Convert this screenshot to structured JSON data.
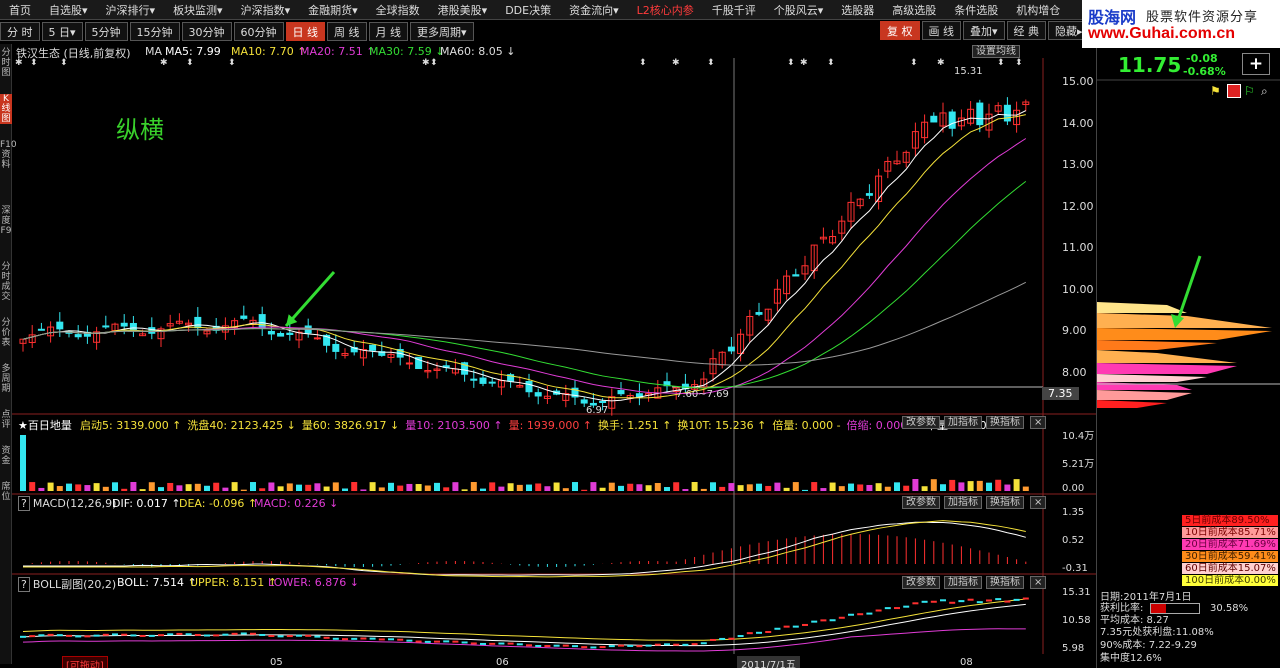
{
  "menu": [
    "首页",
    "自选股▾",
    "沪深排行▾",
    "板块监测▾",
    "沪深指数▾",
    "金融期货▾",
    "全球指数",
    "港股美股▾",
    "DDE决策",
    "资金流向▾",
    "L2核心内参",
    "千股千评",
    "个股风云▾",
    "选股器",
    "高级选股",
    "条件选股",
    "机构增仓"
  ],
  "menu_hot_index": 10,
  "logo": {
    "brand": "股海网",
    "tagline": "股票软件资源分享",
    "url": "www.Guhai.com.cn"
  },
  "periods": [
    "分 时",
    "5 日▾",
    "5分钟",
    "15分钟",
    "30分钟",
    "60分钟",
    "日 线",
    "周 线",
    "月 线",
    "更多周期▾"
  ],
  "active_period": "日 线",
  "right_buttons": [
    "复 权",
    "画 线",
    "叠加▾",
    "经 典",
    "隐藏▸"
  ],
  "left_nav": [
    "分时图",
    "K线图",
    "F10资料",
    "深度F9",
    "分时成交",
    "分价表",
    "多周期",
    "点评",
    "资金",
    "席位"
  ],
  "stock_header": "铁汉生态 (日线,前复权)",
  "ma": {
    "label": "MA",
    "ma5": "MA5: 7.99",
    "ma10": "MA10: 7.70 ↑",
    "ma20": "MA20: 7.51 ↑",
    "ma30": "MA30: 7.59 ↓",
    "ma60": "MA60: 8.05 ↓"
  },
  "settings_btn": "设置均线",
  "annotation": "纵横",
  "high_label": "15.31",
  "low_label": "6.97",
  "cross_label": "7.60~7.69",
  "price_axis": [
    "15.00",
    "14.00",
    "13.00",
    "12.00",
    "11.00",
    "10.00",
    "9.00",
    "8.00"
  ],
  "price_marker": "7.35",
  "volume_panel": {
    "title": "★百日地量",
    "items": [
      [
        "启动5: 3139.000 ↑",
        "#f5e23a"
      ],
      [
        "洗盘40: 2123.425 ↓",
        "#f5e23a"
      ],
      [
        "量60: 3826.917 ↓",
        "#f5e23a"
      ],
      [
        "量10: 2103.500 ↑",
        "#e03cd6"
      ],
      [
        "量: 1939.000 ↑",
        "#ff4040"
      ],
      [
        "换手: 1.251 ↑",
        "#f5e23a"
      ],
      [
        "换10T: 15.236 ↑",
        "#f5e23a"
      ],
      [
        "倍量: 0.000 -",
        "#f5e23a"
      ],
      [
        "倍缩: 0.000 ↓",
        "#e03cd6"
      ],
      [
        "平量: 1.000 ↑",
        "#ffffff"
      ]
    ],
    "axis": [
      "10.4万",
      "5.21万",
      "0.00"
    ]
  },
  "macd_panel": {
    "title": "MACD(12,26,9)",
    "dif": "DIF: 0.017 ↑",
    "dea": "DEA: -0.096 ↑",
    "macd": "MACD: 0.226 ↓",
    "axis": [
      "1.35",
      "0.52",
      "-0.31"
    ]
  },
  "boll_panel": {
    "title": "BOLL副图(20,2)",
    "boll": "BOLL: 7.514 ↑",
    "upper": "UPPER: 8.151 ↑",
    "lower": "LOWER: 6.876 ↓",
    "axis": [
      "15.31",
      "10.58",
      "5.98"
    ]
  },
  "panel_buttons": [
    "改参数",
    "加指标",
    "换指标",
    "×"
  ],
  "x_axis": [
    "05",
    "06",
    "08"
  ],
  "x_axis_date": "2011/7/1五",
  "draggable": "[可拖动]",
  "quote": {
    "price": "11.75",
    "change": "-0.08",
    "pct": "-0.68%",
    "plus": "+"
  },
  "cost_legend": [
    {
      "text": "5日前成本89.50%",
      "bg": "#ff2020",
      "fg": "#6b0000"
    },
    {
      "text": "10日前成本85.71%",
      "bg": "#ff9a9a",
      "fg": "#7a0000"
    },
    {
      "text": "20日前成本71.69%",
      "bg": "#ff3ab3",
      "fg": "#6b0040"
    },
    {
      "text": "30日前成本59.41%",
      "bg": "#ff8c1a",
      "fg": "#402000"
    },
    {
      "text": "60日前成本15.07%",
      "bg": "#ffd0d0",
      "fg": "#600000"
    },
    {
      "text": "100日前成本0.00%",
      "bg": "#ffff3a",
      "fg": "#404000"
    }
  ],
  "chip_info": {
    "date": "日期:2011年7月1日",
    "ratio_label": "获利比率:",
    "ratio_value": "30.58%",
    "avg": "平均成本: 8.27",
    "profit": "7.35元处获利盘:11.08%",
    "cost90": "90%成本: 7.22-9.29",
    "conc": "集中度12.6%"
  }
}
